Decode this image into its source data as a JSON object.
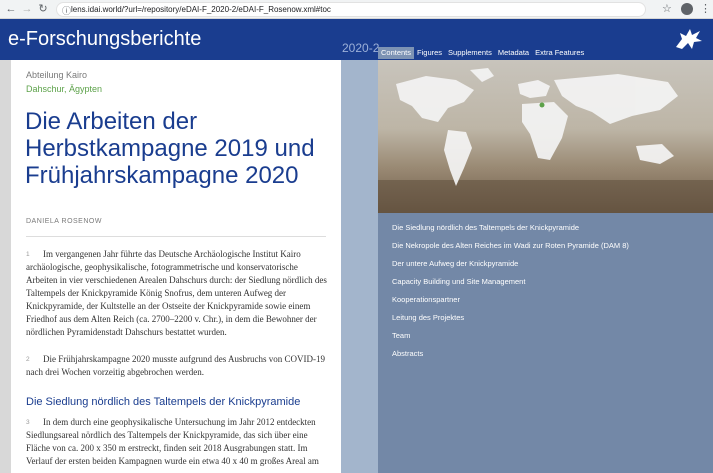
{
  "browser": {
    "url_text": "lens.idai.world/?url=/repository/eDAI-F_2020-2/eDAI-F_Rosenow.xml#toc"
  },
  "header": {
    "site_title": "e-Forschungsberichte",
    "volume": "2020-2",
    "tabs": [
      {
        "label": "Contents",
        "active": true
      },
      {
        "label": "Figures",
        "active": false
      },
      {
        "label": "Supplements",
        "active": false
      },
      {
        "label": "Metadata",
        "active": false
      },
      {
        "label": "Extra Features",
        "active": false
      }
    ]
  },
  "article": {
    "department": "Abteilung Kairo",
    "place": "Dahschur, Ägypten",
    "title": "Die Arbeiten der Herbstkampagne 2019 und Frühjahrskampagne 2020",
    "author": "DANIELA ROSENOW",
    "paragraphs": [
      {
        "num": "1",
        "text": "Im vergangenen Jahr führte das Deutsche Archäologische Institut Kairo archäologische, geophysikalische, fotogrammetrische und konservatorische Arbeiten in vier verschiedenen Arealen Dahschurs durch: der Siedlung nördlich des Taltempels der Knickpyramide König Snofrus, dem unteren Aufweg der Knickpyramide, der Kultstelle an der Ostseite der Knickpyramide sowie einem Friedhof aus dem Alten Reich (ca. 2700–2200 v. Chr.), in dem die Bewohner der nördlichen Pyramidenstadt Dahschurs bestattet wurden."
      },
      {
        "num": "2",
        "text": "Die Frühjahrskampagne 2020 musste aufgrund des Ausbruchs von COVID-19 nach drei Wochen vorzeitig abgebrochen werden."
      },
      {
        "num": "3",
        "text": "In dem durch eine geophysikalische Untersuchung im Jahr 2012 entdeckten Siedlungsareal nördlich des Taltempels der Knickpyramide, das sich über eine Fläche von ca. 200 x 350 m erstreckt, finden seit 2018 Ausgrabungen statt. Im Verlauf der ersten beiden Kampagnen wurde ein etwa 40 x 40 m großes Areal am"
      }
    ],
    "section_heading": "Die Siedlung nördlich des Taltempels der Knickpyramide"
  },
  "toc": {
    "items": [
      "Die Siedlung nördlich des Taltempels der Knickpyramide",
      "Die Nekropole des Alten Reiches im Wadi zur Roten Pyramide (DAM 8)",
      "Der untere Aufweg der Knickpyramide",
      "Capacity Building und Site Management",
      "Kooperationspartner",
      "Leitung des Projektes",
      "Team",
      "Abstracts"
    ]
  },
  "colors": {
    "header_blue": "#1a3d8f",
    "panel_blue": "#7388a7",
    "place_green": "#5da24a",
    "active_tab": "#7d93b4"
  }
}
